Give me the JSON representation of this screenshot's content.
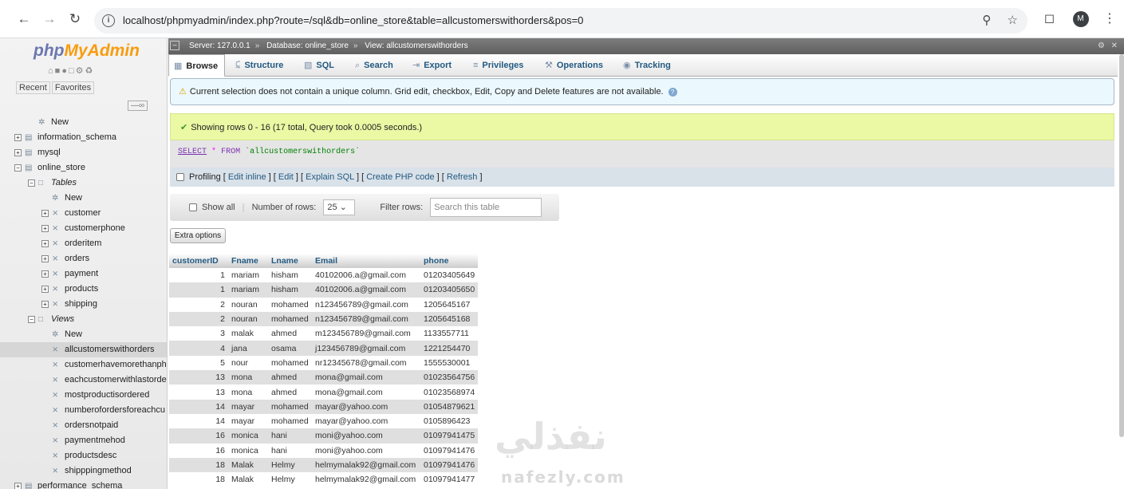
{
  "browser": {
    "url": "localhost/phpmyadmin/index.php?route=/sql&db=online_store&table=allcustomerswithorders&pos=0",
    "avatar_letter": "M"
  },
  "sidebar": {
    "logo_php": "php",
    "logo_myadmin": "MyAdmin",
    "recent": "Recent",
    "favorites": "Favorites",
    "tree": [
      {
        "label": "New",
        "depth": 1,
        "type": "new"
      },
      {
        "label": "information_schema",
        "depth": 0,
        "type": "db"
      },
      {
        "label": "mysql",
        "depth": 0,
        "type": "db"
      },
      {
        "label": "online_store",
        "depth": 0,
        "type": "db"
      },
      {
        "label": "Tables",
        "depth": 1,
        "type": "group"
      },
      {
        "label": "New",
        "depth": 2,
        "type": "new"
      },
      {
        "label": "customer",
        "depth": 2,
        "type": "table"
      },
      {
        "label": "customerphone",
        "depth": 2,
        "type": "table"
      },
      {
        "label": "orderitem",
        "depth": 2,
        "type": "table"
      },
      {
        "label": "orders",
        "depth": 2,
        "type": "table"
      },
      {
        "label": "payment",
        "depth": 2,
        "type": "table"
      },
      {
        "label": "products",
        "depth": 2,
        "type": "table"
      },
      {
        "label": "shipping",
        "depth": 2,
        "type": "table"
      },
      {
        "label": "Views",
        "depth": 1,
        "type": "group"
      },
      {
        "label": "New",
        "depth": 2,
        "type": "new"
      },
      {
        "label": "allcustomerswithorders",
        "depth": 2,
        "type": "view",
        "selected": true
      },
      {
        "label": "customerhavemorethanph",
        "depth": 2,
        "type": "view"
      },
      {
        "label": "eachcustomerwithlastorde",
        "depth": 2,
        "type": "view"
      },
      {
        "label": "mostproductisordered",
        "depth": 2,
        "type": "view"
      },
      {
        "label": "numberofordersforeachcu",
        "depth": 2,
        "type": "view"
      },
      {
        "label": "ordersnotpaid",
        "depth": 2,
        "type": "view"
      },
      {
        "label": "paymentmehod",
        "depth": 2,
        "type": "view"
      },
      {
        "label": "productsdesc",
        "depth": 2,
        "type": "view"
      },
      {
        "label": "shipppingmethod",
        "depth": 2,
        "type": "view"
      },
      {
        "label": "performance_schema",
        "depth": 0,
        "type": "db"
      }
    ]
  },
  "breadcrumb": {
    "server": "Server: 127.0.0.1",
    "database": "Database: online_store",
    "view": "View: allcustomerswithorders"
  },
  "tabs": [
    {
      "label": "Browse",
      "icon": "browse-icon",
      "active": true
    },
    {
      "label": "Structure",
      "icon": "structure-icon"
    },
    {
      "label": "SQL",
      "icon": "sql-icon"
    },
    {
      "label": "Search",
      "icon": "search-icon"
    },
    {
      "label": "Export",
      "icon": "export-icon"
    },
    {
      "label": "Privileges",
      "icon": "privileges-icon"
    },
    {
      "label": "Operations",
      "icon": "operations-icon"
    },
    {
      "label": "Tracking",
      "icon": "tracking-icon"
    }
  ],
  "notice": "Current selection does not contain a unique column. Grid edit, checkbox, Edit, Copy and Delete features are not available.",
  "success": "Showing rows 0 - 16 (17 total, Query took 0.0005 seconds.)",
  "sql": {
    "select": "SELECT",
    "star": "*",
    "from": "FROM",
    "table": "`allcustomerswithorders`"
  },
  "profiling": {
    "label": "Profiling",
    "links": [
      "Edit inline",
      "Edit",
      "Explain SQL",
      "Create PHP code",
      "Refresh"
    ]
  },
  "navbar": {
    "show_all": "Show all",
    "rows_label": "Number of rows:",
    "rows_value": "25",
    "filter_label": "Filter rows:",
    "filter_placeholder": "Search this table"
  },
  "extra_options": "Extra options",
  "table": {
    "columns": [
      "customerID",
      "Fname",
      "Lname",
      "Email",
      "phone"
    ],
    "rows": [
      [
        "1",
        "mariam",
        "hisham",
        "40102006.a@gmail.com",
        "01203405649"
      ],
      [
        "1",
        "mariam",
        "hisham",
        "40102006.a@gmail.com",
        "01203405650"
      ],
      [
        "2",
        "nouran",
        "mohamed",
        "n123456789@gmail.com",
        "1205645167"
      ],
      [
        "2",
        "nouran",
        "mohamed",
        "n123456789@gmail.com",
        "1205645168"
      ],
      [
        "3",
        "malak",
        "ahmed",
        "m123456789@gmail.com",
        "1133557711"
      ],
      [
        "4",
        "jana",
        "osama",
        "j123456789@gmail.com",
        "1221254470"
      ],
      [
        "5",
        "nour",
        "mohamed",
        "nr12345678@gmail.com",
        "1555530001"
      ],
      [
        "13",
        "mona",
        "ahmed",
        "mona@gmail.com",
        "01023564756"
      ],
      [
        "13",
        "mona",
        "ahmed",
        "mona@gmail.com",
        "01023568974"
      ],
      [
        "14",
        "mayar",
        "mohamed",
        "mayar@yahoo.com",
        "01054879621"
      ],
      [
        "14",
        "mayar",
        "mohamed",
        "mayar@yahoo.com",
        "0105896423"
      ],
      [
        "16",
        "monica",
        "hani",
        "moni@yahoo.com",
        "01097941475"
      ],
      [
        "16",
        "monica",
        "hani",
        "moni@yahoo.com",
        "01097941476"
      ],
      [
        "18",
        "Malak",
        "Helmy",
        "helmymalak92@gmail.com",
        "01097941476"
      ],
      [
        "18",
        "Malak",
        "Helmy",
        "helmymalak92@gmail.com",
        "01097941477"
      ]
    ]
  },
  "watermark": {
    "arabic": "نفذلي",
    "latin": "nafezly.com"
  }
}
